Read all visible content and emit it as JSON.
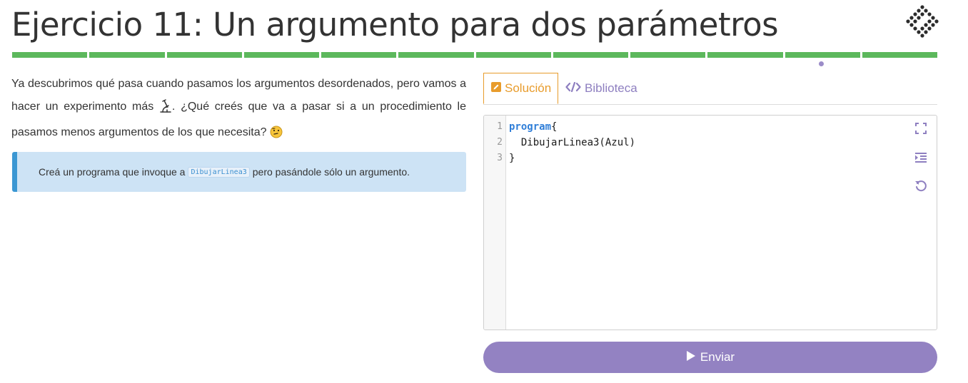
{
  "header": {
    "title": "Ejercicio 11: Un argumento para dos parámetros",
    "logo_icon": "mumuki-diamond-logo"
  },
  "progress": {
    "total_exercises": 12,
    "current_exercise": 11,
    "color": "#5cb85c",
    "marker_color": "#9b8cc8"
  },
  "description": {
    "part1": "Ya descubrimos qué pasa cuando pasamos los argumentos desordenados, pero vamos a hacer un experimento más ",
    "icon1": "microscope-emoji",
    "part2": ". ¿Qué creés que va a pasar si a un procedimiento le pasamos menos argumentos de los que necesita? ",
    "icon2": "thinking-face-emoji"
  },
  "callout": {
    "text_before": "Creá un programa que invoque a ",
    "code": "DibujarLinea3",
    "text_after": " pero pasándole sólo un argumento.",
    "accent_color": "#3b97d3",
    "background": "#cde3f5"
  },
  "tabs": {
    "solution": {
      "label": "Solución",
      "icon": "edit-icon",
      "color": "#e89c2c",
      "active": true
    },
    "library": {
      "label": "Biblioteca",
      "icon": "code-icon",
      "color": "#8e7fc0",
      "active": false
    }
  },
  "editor": {
    "lines": [
      {
        "number": "1",
        "keyword": "program",
        "rest": "{"
      },
      {
        "number": "2",
        "keyword": "",
        "rest": "  DibujarLinea3(Azul)"
      },
      {
        "number": "3",
        "keyword": "",
        "rest": "}"
      }
    ],
    "tools": [
      "fullscreen-icon",
      "indent-icon",
      "reset-icon"
    ]
  },
  "submit": {
    "label": "Enviar",
    "icon": "play-icon",
    "color": "#9382c2"
  }
}
